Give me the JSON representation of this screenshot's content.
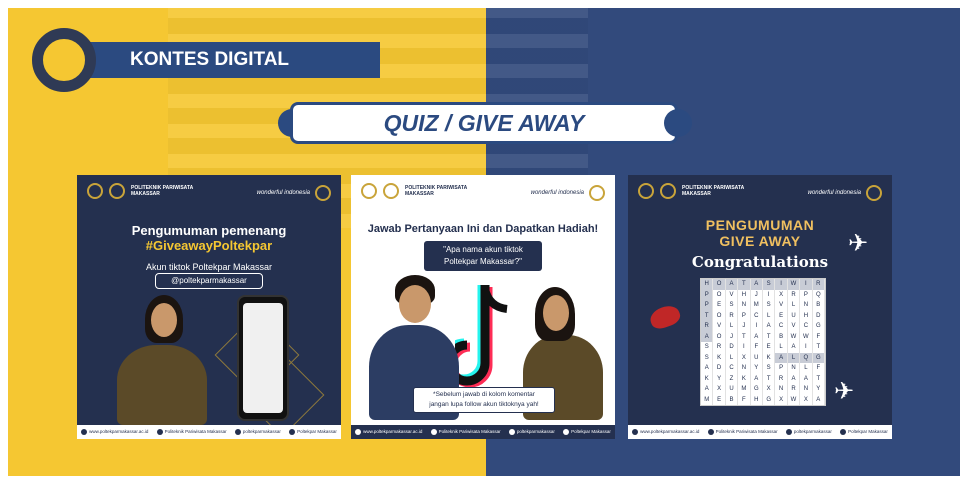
{
  "header": {
    "title": "KONTES DIGITAL",
    "subtitle": "QUIZ / GIVE AWAY"
  },
  "colors": {
    "yellow": "#f5c732",
    "blue": "#2b4a80",
    "navy": "#24304f"
  },
  "posters": [
    {
      "org": "POLITEKNIK PARIWISATA MAKASSAR",
      "brand": "wonderful indonesia",
      "heading": "Pengumuman pemenang",
      "hashtag": "#GiveawayPoltekpar",
      "sub": "Akun tiktok Poltekpar Makassar",
      "handle": "@poltekparmakassar",
      "footer": [
        "www.poltekparmakassar.ac.id",
        "Politeknik Pariwisata Makassar",
        "poltekparmakassar",
        "Poltekpar Makassar"
      ]
    },
    {
      "org": "POLITEKNIK PARIWISATA MAKASSAR",
      "brand": "wonderful indonesia",
      "heading": "Jawab Pertanyaan Ini dan Dapatkan Hadiah!",
      "question": "\"Apa nama akun tiktok\nPoltekpar Makassar?\"",
      "note": "*Sebelum jawab di kolom komentar\njangan lupa follow akun tiktoknya yah!",
      "footer": [
        "www.poltekparmakassar.ac.id",
        "Politeknik Pariwisata Makassar",
        "poltekparmakassar",
        "Poltekpar Makassar"
      ]
    },
    {
      "org": "POLITEKNIK PARIWISATA MAKASSAR",
      "brand": "wonderful indonesia",
      "title1": "PENGUMUMAN",
      "title2": "GIVE AWAY",
      "title3": "Congratulations",
      "grid": [
        "HOATASIWIRAP",
        "POVHJIXRPQLR",
        "PESNMSVLNBX",
        "TORPCLEUHDGS",
        "RVLJIACVCGZF",
        "AOJTATBWWFRM",
        "SRDIFELAITRFG",
        "SKLXUKALQGHT",
        "ADCNYSPNLFHA",
        "KYZKATRAATQY",
        "AXUMGXNRNYA",
        "MEBFHGXWXALW"
      ],
      "footer": [
        "www.poltekparmakassar.ac.id",
        "Politeknik Pariwisata Makassar",
        "poltekparmakassar",
        "Poltekpar Makassar"
      ]
    }
  ]
}
